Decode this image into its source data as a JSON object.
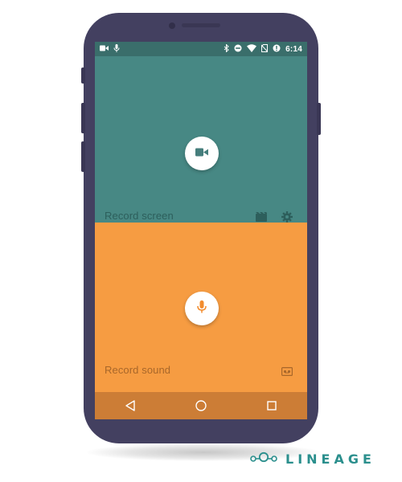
{
  "status_bar": {
    "time": "6:14",
    "left_icons": [
      "videocam-icon",
      "mic-icon"
    ],
    "right_icons": [
      "bluetooth-icon",
      "do-not-disturb-icon",
      "wifi-icon",
      "no-sim-icon",
      "data-saver-icon"
    ]
  },
  "record_screen": {
    "label": "Record screen",
    "button_icon": "videocam-icon",
    "actions": [
      "movie-clapper-icon",
      "settings-gear-icon"
    ],
    "color": "#478884"
  },
  "record_sound": {
    "label": "Record sound",
    "button_icon": "mic-icon",
    "actions": [
      "audio-tape-icon"
    ],
    "color": "#f69c42"
  },
  "nav_bar": {
    "buttons": [
      "back-icon",
      "home-icon",
      "recents-icon"
    ],
    "color": "#cc7d36"
  },
  "brand": {
    "name": "LINEAGE",
    "color": "#2b8f8d"
  },
  "device": {
    "frame_color": "#434060"
  }
}
